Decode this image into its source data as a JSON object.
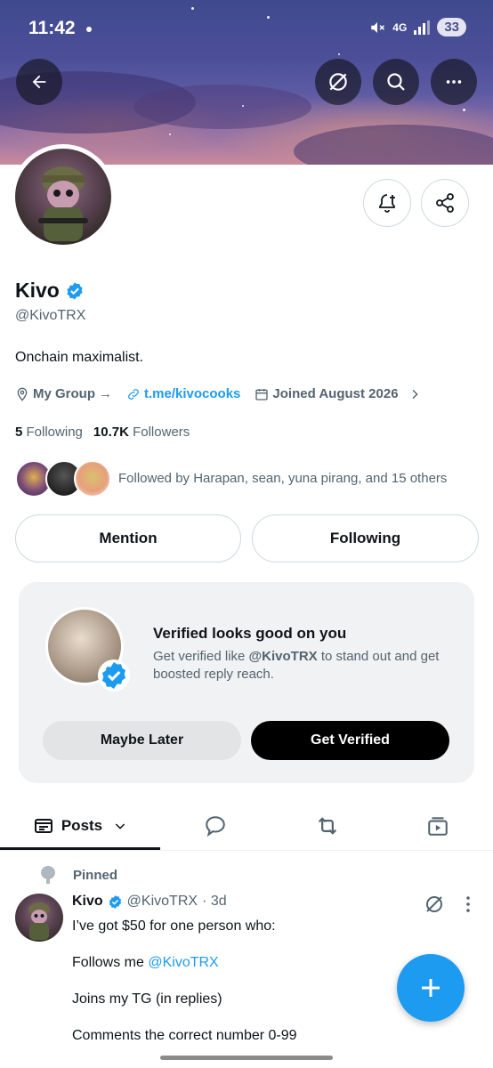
{
  "status_bar": {
    "time": "11:42",
    "network": "4G",
    "battery": "33"
  },
  "header": {
    "back_icon": "arrow-left-icon",
    "grok_icon": "slash-circle-icon",
    "search_icon": "search-icon",
    "more_icon": "more-horizontal-icon"
  },
  "profile": {
    "name": "Kivo",
    "handle": "@KivoTRX",
    "bio": "Onchain maximalist.",
    "group": "My Group",
    "group_arrow": "→",
    "link": "t.me/kivocooks",
    "joined": "Joined August 2026",
    "following_count": "5",
    "following_label": "Following",
    "followers_count": "10.7K",
    "followers_label": "Followers",
    "followed_by": "Followed by Harapan, sean, yuna pirang, and 15 others"
  },
  "actions": {
    "mention": "Mention",
    "following": "Following"
  },
  "verify_card": {
    "title": "Verified looks good on you",
    "subtitle_pre": "Get verified like ",
    "subtitle_handle": "@KivoTRX",
    "subtitle_post": " to stand out and get boosted reply reach.",
    "maybe_later": "Maybe Later",
    "get_verified": "Get Verified"
  },
  "tabs": {
    "posts": "Posts"
  },
  "post": {
    "pinned": "Pinned",
    "name": "Kivo",
    "handle": "@KivoTRX",
    "time": "· 3d",
    "line1": "I’ve got $50 for one person who:",
    "line2_pre": "Follows me ",
    "line2_mention": "@KivoTRX",
    "line3": "Joins my TG (in replies)",
    "line4": "Comments the correct number 0-99"
  },
  "colors": {
    "accent": "#1d9bf0",
    "text": "#0f1419",
    "muted": "#536471"
  }
}
